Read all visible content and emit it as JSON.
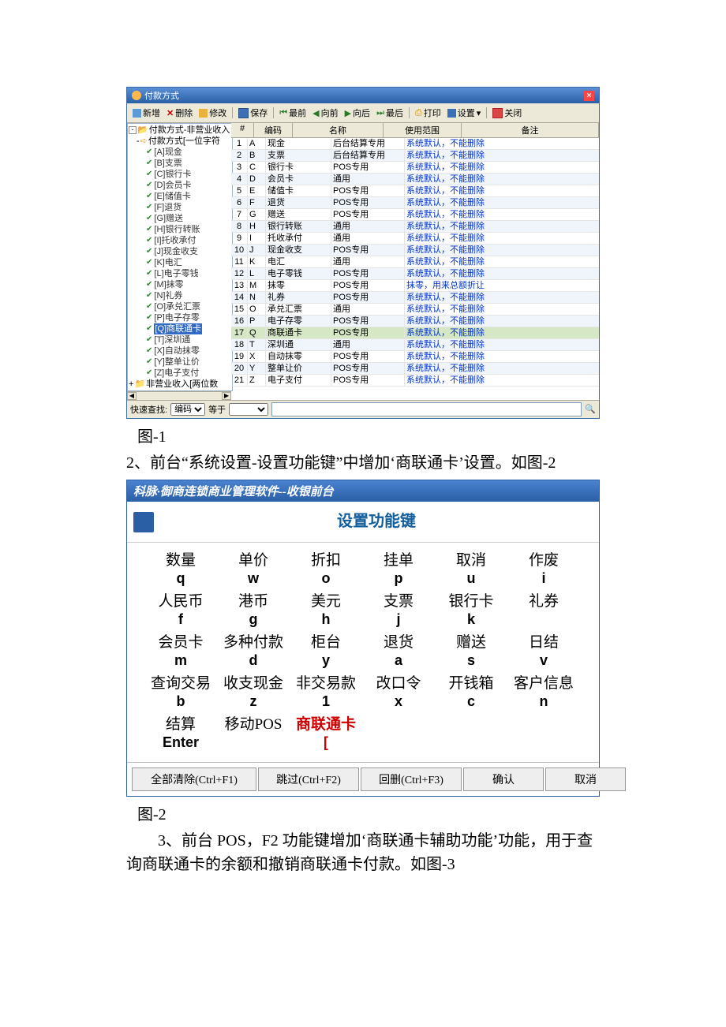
{
  "win1": {
    "title": "付款方式",
    "toolbar": {
      "new": "新增",
      "del": "删除",
      "edit": "修改",
      "save": "保存",
      "first": "最前",
      "prev": "向前",
      "next": "向后",
      "last": "最后",
      "print": "打印",
      "settings": "设置",
      "close": "关闭"
    },
    "tree": {
      "root": "付款方式-非营业收入",
      "group": "付款方式[一位字符",
      "leaves": [
        "[A]现金",
        "[B]支票",
        "[C]银行卡",
        "[D]会员卡",
        "[E]储值卡",
        "[F]退货",
        "[G]赠送",
        "[H]银行转账",
        "[I]托收承付",
        "[J]现金收支",
        "[K]电汇",
        "[L]电子零钱",
        "[M]抹零",
        "[N]礼券",
        "[O]承兑汇票",
        "[P]电子存零",
        "[Q]商联通卡",
        "[T]深圳通",
        "[X]自动抹零",
        "[Y]整单让价",
        "[Z]电子支付"
      ],
      "root2": "非营业收入[两位数",
      "selected": 16
    },
    "grid": {
      "headers": {
        "num": "#",
        "code": "编码",
        "name": "名称",
        "scope": "使用范围",
        "remark": "备注"
      },
      "rows": [
        {
          "n": "1",
          "c": "A",
          "name": "现金",
          "scope": "后台结算专用",
          "rem": "系统默认，不能删除"
        },
        {
          "n": "2",
          "c": "B",
          "name": "支票",
          "scope": "后台结算专用",
          "rem": "系统默认，不能删除"
        },
        {
          "n": "3",
          "c": "C",
          "name": "银行卡",
          "scope": "POS专用",
          "rem": "系统默认，不能删除"
        },
        {
          "n": "4",
          "c": "D",
          "name": "会员卡",
          "scope": "通用",
          "rem": "系统默认，不能删除"
        },
        {
          "n": "5",
          "c": "E",
          "name": "储值卡",
          "scope": "POS专用",
          "rem": "系统默认，不能删除"
        },
        {
          "n": "6",
          "c": "F",
          "name": "退货",
          "scope": "POS专用",
          "rem": "系统默认，不能删除"
        },
        {
          "n": "7",
          "c": "G",
          "name": "赠送",
          "scope": "POS专用",
          "rem": "系统默认，不能删除"
        },
        {
          "n": "8",
          "c": "H",
          "name": "银行转账",
          "scope": "通用",
          "rem": "系统默认，不能删除"
        },
        {
          "n": "9",
          "c": "I",
          "name": "托收承付",
          "scope": "通用",
          "rem": "系统默认，不能删除"
        },
        {
          "n": "10",
          "c": "J",
          "name": "现金收支",
          "scope": "POS专用",
          "rem": "系统默认，不能删除"
        },
        {
          "n": "11",
          "c": "K",
          "name": "电汇",
          "scope": "通用",
          "rem": "系统默认，不能删除"
        },
        {
          "n": "12",
          "c": "L",
          "name": "电子零钱",
          "scope": "POS专用",
          "rem": "系统默认，不能删除"
        },
        {
          "n": "13",
          "c": "M",
          "name": "抹零",
          "scope": "POS专用",
          "rem": "抹零，用来总额折让"
        },
        {
          "n": "14",
          "c": "N",
          "name": "礼券",
          "scope": "POS专用",
          "rem": "系统默认，不能删除"
        },
        {
          "n": "15",
          "c": "O",
          "name": "承兑汇票",
          "scope": "通用",
          "rem": "系统默认，不能删除"
        },
        {
          "n": "16",
          "c": "P",
          "name": "电子存零",
          "scope": "POS专用",
          "rem": "系统默认，不能删除"
        },
        {
          "n": "17",
          "c": "Q",
          "name": "商联通卡",
          "scope": "POS专用",
          "rem": "系统默认，不能删除"
        },
        {
          "n": "18",
          "c": "T",
          "name": "深圳通",
          "scope": "通用",
          "rem": "系统默认，不能删除"
        },
        {
          "n": "19",
          "c": "X",
          "name": "自动抹零",
          "scope": "POS专用",
          "rem": "系统默认，不能删除"
        },
        {
          "n": "20",
          "c": "Y",
          "name": "整单让价",
          "scope": "POS专用",
          "rem": "系统默认，不能删除"
        },
        {
          "n": "21",
          "c": "Z",
          "name": "电子支付",
          "scope": "POS专用",
          "rem": "系统默认，不能删除"
        }
      ],
      "selected": 16
    },
    "qfind": {
      "label": "快速查找:",
      "field": "编码",
      "op": "等于"
    }
  },
  "caption1": "图-1",
  "text2": "2、前台“系统设置-设置功能键”中增加‘商联通卡’设置。如图-2",
  "win2": {
    "title": "科脉·御商连锁商业管理软件--收银前台",
    "header": "设置功能键",
    "keys": [
      [
        {
          "l": "数量",
          "k": "q"
        },
        {
          "l": "单价",
          "k": "w"
        },
        {
          "l": "折扣",
          "k": "o"
        },
        {
          "l": "挂单",
          "k": "p"
        },
        {
          "l": "取消",
          "k": "u"
        },
        {
          "l": "作废",
          "k": "i"
        }
      ],
      [
        {
          "l": "人民币",
          "k": "f"
        },
        {
          "l": "港币",
          "k": "g"
        },
        {
          "l": "美元",
          "k": "h"
        },
        {
          "l": "支票",
          "k": "j"
        },
        {
          "l": "银行卡",
          "k": "k"
        },
        {
          "l": "礼券",
          "k": ""
        }
      ],
      [
        {
          "l": "会员卡",
          "k": "m"
        },
        {
          "l": "多种付款",
          "k": "d"
        },
        {
          "l": "柜台",
          "k": "y"
        },
        {
          "l": "退货",
          "k": "a"
        },
        {
          "l": "赠送",
          "k": "s"
        },
        {
          "l": "日结",
          "k": "v"
        }
      ],
      [
        {
          "l": "查询交易",
          "k": "b"
        },
        {
          "l": "收支现金",
          "k": "z"
        },
        {
          "l": "非交易款",
          "k": "1"
        },
        {
          "l": "改口令",
          "k": "x"
        },
        {
          "l": "开钱箱",
          "k": "c"
        },
        {
          "l": "客户信息",
          "k": "n"
        }
      ],
      [
        {
          "l": "结算",
          "k": "Enter"
        },
        {
          "l": "移动POS",
          "k": ""
        },
        {
          "l": "商联通卡",
          "k": "[",
          "red": true
        }
      ]
    ],
    "buttons": {
      "clear": "全部清除(Ctrl+F1)",
      "skip": "跳过(Ctrl+F2)",
      "undo": "回删(Ctrl+F3)",
      "ok": "确认",
      "cancel": "取消"
    }
  },
  "caption2": "图-2",
  "text3": "3、前台 POS，F2 功能键增加‘商联通卡辅助功能’功能，用于查询商联通卡的余额和撤销商联通卡付款。如图-3"
}
